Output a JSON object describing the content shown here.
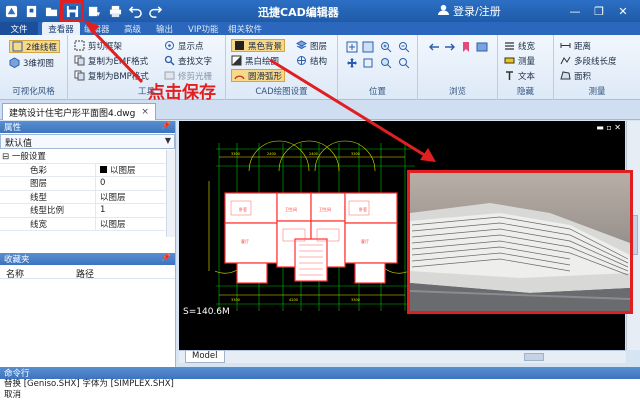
{
  "app": {
    "title": "迅捷CAD编辑器",
    "login": "登录/注册"
  },
  "ribbon_tabs": [
    "文件",
    "查看器",
    "编辑器",
    "高级",
    "输出",
    "VIP功能",
    "相关软件"
  ],
  "ribbon": {
    "visual_style": {
      "items": [
        "2维线框",
        "3维视图"
      ],
      "title": "可视化风格"
    },
    "tools": {
      "items": [
        "剪切框架",
        "复制为EMF格式",
        "复制为BMP格式",
        "显示点",
        "查找文字",
        "修剪光栅"
      ],
      "title": "工具"
    },
    "cad_settings": {
      "items": [
        "黑色背景",
        "黑白绘图",
        "圆滑弧形",
        "图层",
        "结构"
      ],
      "title": "CAD绘图设置"
    },
    "position": {
      "title": "位置"
    },
    "browse": {
      "title": "浏览"
    },
    "hide": {
      "items": [
        "线宽",
        "测量",
        "文本"
      ],
      "title": "隐藏"
    },
    "measure": {
      "items": [
        "距离",
        "多段线长度",
        "面积"
      ],
      "title": "测量"
    }
  },
  "document": {
    "tab": "建筑设计住宅户形平面图4.dwg",
    "close": "×"
  },
  "properties": {
    "header": "属性",
    "dropdown": "默认值",
    "group": "⊟ 一般设置",
    "rows": [
      {
        "key": "色彩",
        "value": "以图层"
      },
      {
        "key": "图层",
        "value": "0"
      },
      {
        "key": "线型",
        "value": "以图层"
      },
      {
        "key": "线型比例",
        "value": "1"
      },
      {
        "key": "线宽",
        "value": "以图层"
      }
    ]
  },
  "favorites": {
    "header": "收藏夹",
    "col_name": "名称",
    "col_path": "路径"
  },
  "canvas": {
    "scale_label": "S=140.6M",
    "model_tab": "Model",
    "controls": "▬ ▫ ✕"
  },
  "command": {
    "header": "命令行",
    "lines": [
      "替换 [Geniso.SHX] 字体为 [SIMPLEX.SHX]",
      "取消"
    ]
  },
  "annotation": {
    "text": "点击保存"
  },
  "colors": {
    "titlebar": "#2c6fc4",
    "annotation": "#e02020",
    "canvas_bg": "#000000",
    "wall": "#ff3030",
    "wall_fill": "#ffffff",
    "dim_lines": "#e6e600",
    "axis": "#00d000"
  }
}
